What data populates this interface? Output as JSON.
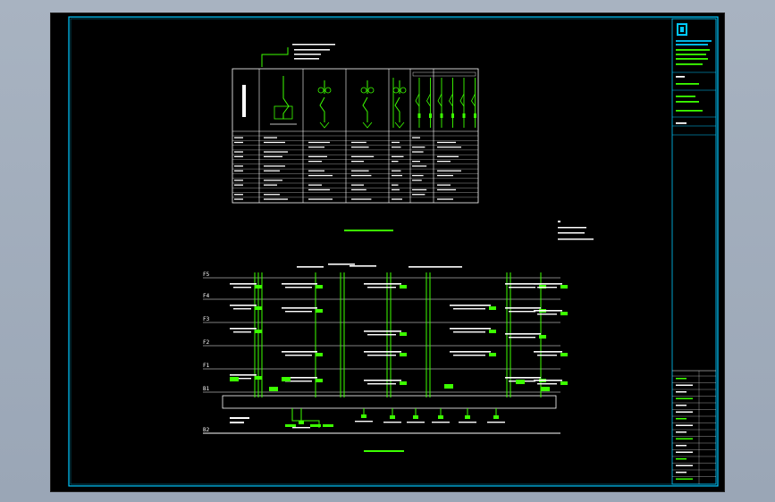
{
  "title_block": {
    "logo_icon": "building-logo-icon",
    "company": "",
    "project": "",
    "drawing_name": "",
    "sheet_no": "",
    "scale": ""
  },
  "riser": {
    "floor_labels": [
      "F5",
      "F4",
      "F3",
      "F2",
      "F1",
      "B1",
      "B2"
    ]
  },
  "colors": {
    "background": "#000000",
    "frame": "#00c8ff",
    "line": "#ffffff",
    "equipment": "#3cff00",
    "title_band": "#00aa66"
  }
}
